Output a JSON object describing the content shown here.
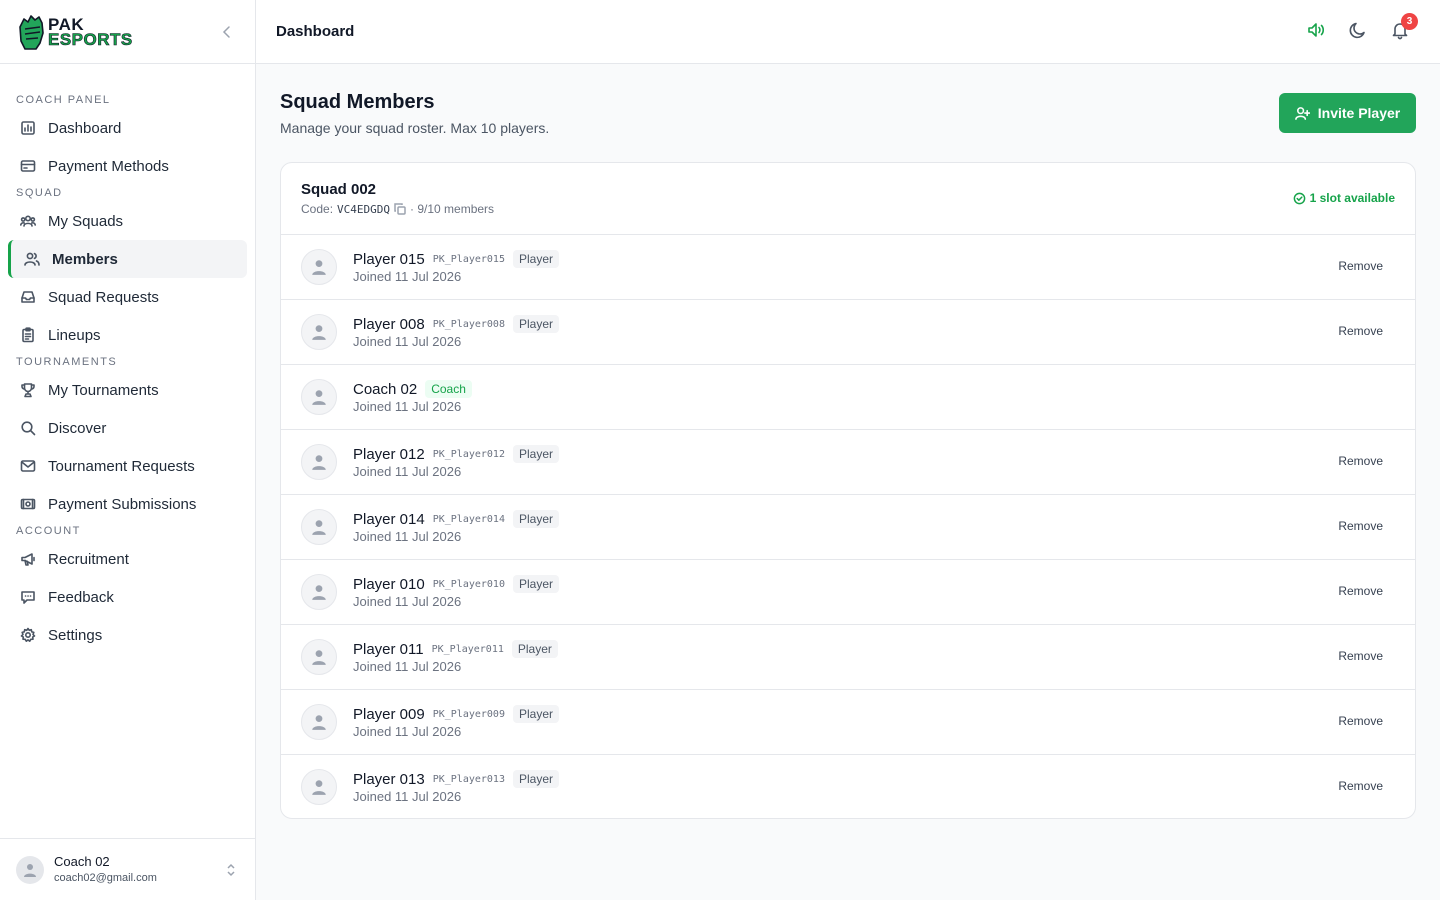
{
  "brand": {
    "line1": "PAK",
    "line2": "ESPORTS"
  },
  "sidebar": {
    "sections": [
      {
        "label": "COACH PANEL",
        "items": [
          {
            "label": "Dashboard",
            "icon": "chart-icon"
          },
          {
            "label": "Payment Methods",
            "icon": "credit-card-icon"
          }
        ]
      },
      {
        "label": "SQUAD",
        "items": [
          {
            "label": "My Squads",
            "icon": "users-group-icon"
          },
          {
            "label": "Members",
            "icon": "users-icon",
            "active": true
          },
          {
            "label": "Squad Requests",
            "icon": "inbox-icon"
          },
          {
            "label": "Lineups",
            "icon": "clipboard-icon"
          }
        ]
      },
      {
        "label": "TOURNAMENTS",
        "items": [
          {
            "label": "My Tournaments",
            "icon": "trophy-icon"
          },
          {
            "label": "Discover",
            "icon": "search-icon"
          },
          {
            "label": "Tournament Requests",
            "icon": "mail-icon"
          },
          {
            "label": "Payment Submissions",
            "icon": "banknote-icon"
          }
        ]
      },
      {
        "label": "ACCOUNT",
        "items": [
          {
            "label": "Recruitment",
            "icon": "megaphone-icon"
          },
          {
            "label": "Feedback",
            "icon": "message-icon"
          },
          {
            "label": "Settings",
            "icon": "gear-icon"
          }
        ]
      }
    ],
    "user": {
      "name": "Coach 02",
      "email": "coach02@gmail.com"
    }
  },
  "topbar": {
    "title": "Dashboard",
    "notification_count": "3"
  },
  "page": {
    "title": "Squad Members",
    "subtitle": "Manage your squad roster. Max 10 players.",
    "invite_label": "Invite Player"
  },
  "squad": {
    "name": "Squad 002",
    "code_label": "Code:",
    "code": "VC4EDGDQ",
    "members_count": "· 9/10 members",
    "slots": "1 slot available"
  },
  "members": [
    {
      "name": "Player 015",
      "handle": "PK_Player015",
      "role": "Player",
      "joined": "Joined 11 Jul 2026",
      "remove": "Remove"
    },
    {
      "name": "Player 008",
      "handle": "PK_Player008",
      "role": "Player",
      "joined": "Joined 11 Jul 2026",
      "remove": "Remove"
    },
    {
      "name": "Coach 02",
      "handle": "",
      "role": "Coach",
      "joined": "Joined 11 Jul 2026",
      "remove": ""
    },
    {
      "name": "Player 012",
      "handle": "PK_Player012",
      "role": "Player",
      "joined": "Joined 11 Jul 2026",
      "remove": "Remove"
    },
    {
      "name": "Player 014",
      "handle": "PK_Player014",
      "role": "Player",
      "joined": "Joined 11 Jul 2026",
      "remove": "Remove"
    },
    {
      "name": "Player 010",
      "handle": "PK_Player010",
      "role": "Player",
      "joined": "Joined 11 Jul 2026",
      "remove": "Remove"
    },
    {
      "name": "Player 011",
      "handle": "PK_Player011",
      "role": "Player",
      "joined": "Joined 11 Jul 2026",
      "remove": "Remove"
    },
    {
      "name": "Player 009",
      "handle": "PK_Player009",
      "role": "Player",
      "joined": "Joined 11 Jul 2026",
      "remove": "Remove"
    },
    {
      "name": "Player 013",
      "handle": "PK_Player013",
      "role": "Player",
      "joined": "Joined 11 Jul 2026",
      "remove": "Remove"
    }
  ],
  "colors": {
    "accent": "#22a55a",
    "badge": "#ef4444"
  }
}
